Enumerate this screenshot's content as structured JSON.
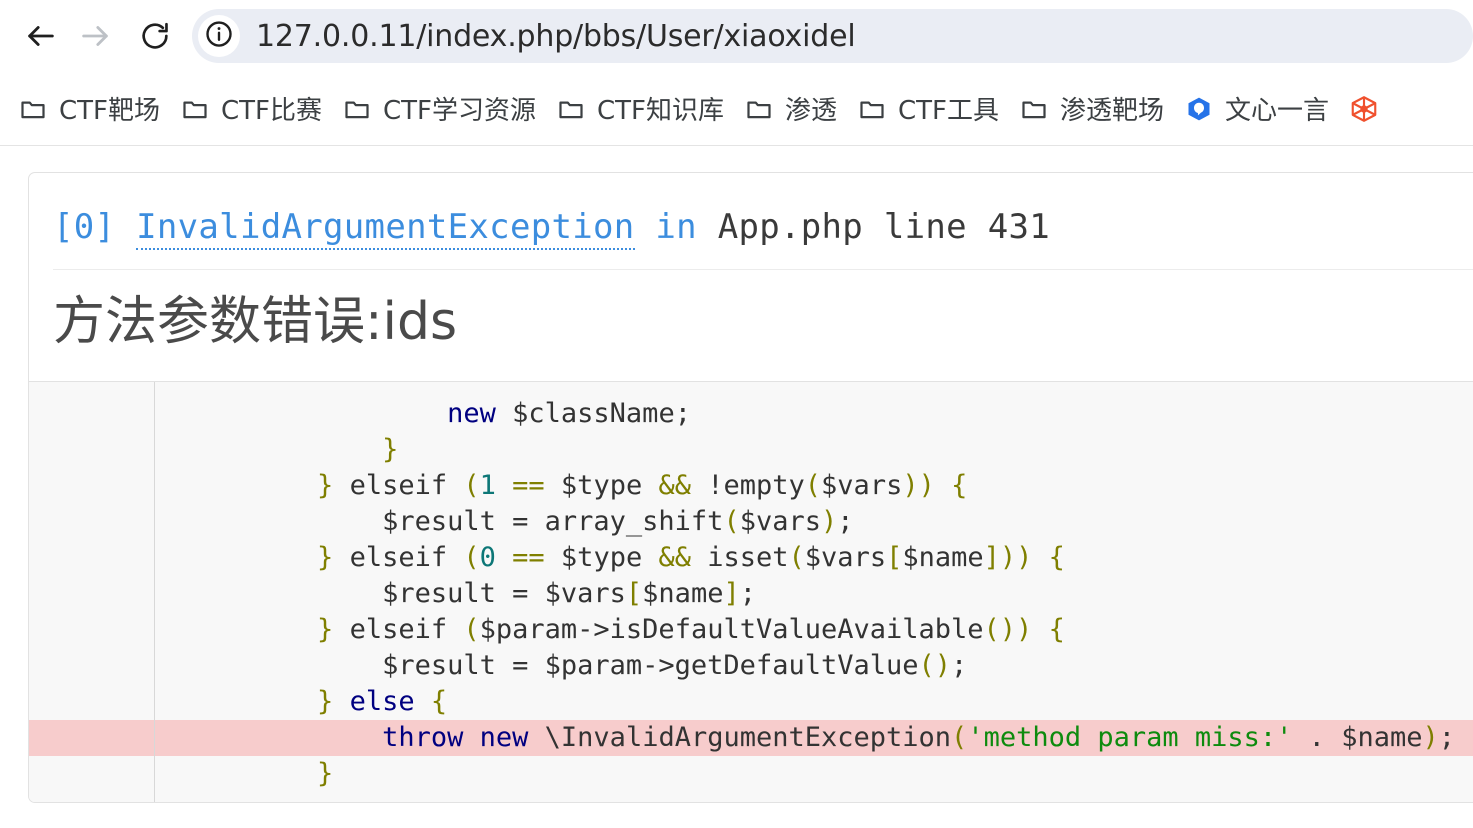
{
  "browser": {
    "toolbar": {
      "back_icon": "back-arrow-icon",
      "forward_icon": "forward-arrow-icon",
      "reload_icon": "reload-icon",
      "site_info_icon": "info-circle-icon",
      "url": "127.0.0.11/index.php/bbs/User/xiaoxidel"
    },
    "bookmarks": [
      {
        "label": "CTF靶场",
        "icon": "folder-icon"
      },
      {
        "label": "CTF比赛",
        "icon": "folder-icon"
      },
      {
        "label": "CTF学习资源",
        "icon": "folder-icon"
      },
      {
        "label": "CTF知识库",
        "icon": "folder-icon"
      },
      {
        "label": "渗透",
        "icon": "folder-icon"
      },
      {
        "label": "CTF工具",
        "icon": "folder-icon"
      },
      {
        "label": "渗透靶场",
        "icon": "folder-icon"
      },
      {
        "label": "文心一言",
        "icon": "ernie-bot-icon"
      },
      {
        "label": "",
        "icon": "hexagon-red-icon"
      }
    ]
  },
  "error_page": {
    "exception": {
      "index": "[0]",
      "class_name": "InvalidArgumentException",
      "in_word": "in",
      "file": "App.php",
      "line_word": "line",
      "line_number": "431",
      "message": "方法参数错误:ids"
    },
    "code": {
      "highlight_line_index": 9,
      "lines": [
        [
          {
            "text": "                ",
            "cls": "t-default"
          },
          {
            "text": "new",
            "cls": "t-kw"
          },
          {
            "text": " ",
            "cls": "t-default"
          },
          {
            "text": "$className",
            "cls": "t-default"
          },
          {
            "text": ";",
            "cls": "t-default"
          }
        ],
        [
          {
            "text": "            ",
            "cls": "t-default"
          },
          {
            "text": "}",
            "cls": "t-punct"
          }
        ],
        [
          {
            "text": "        ",
            "cls": "t-default"
          },
          {
            "text": "}",
            "cls": "t-punct"
          },
          {
            "text": " elseif ",
            "cls": "t-default"
          },
          {
            "text": "(",
            "cls": "t-punct"
          },
          {
            "text": "1",
            "cls": "t-num"
          },
          {
            "text": " ",
            "cls": "t-default"
          },
          {
            "text": "==",
            "cls": "t-op"
          },
          {
            "text": " $type ",
            "cls": "t-default"
          },
          {
            "text": "&&",
            "cls": "t-op"
          },
          {
            "text": " !empty",
            "cls": "t-default"
          },
          {
            "text": "(",
            "cls": "t-punct"
          },
          {
            "text": "$vars",
            "cls": "t-default"
          },
          {
            "text": "))",
            "cls": "t-punct"
          },
          {
            "text": " ",
            "cls": "t-default"
          },
          {
            "text": "{",
            "cls": "t-punct"
          }
        ],
        [
          {
            "text": "            $result = array_shift",
            "cls": "t-default"
          },
          {
            "text": "(",
            "cls": "t-punct"
          },
          {
            "text": "$vars",
            "cls": "t-default"
          },
          {
            "text": ")",
            "cls": "t-punct"
          },
          {
            "text": ";",
            "cls": "t-default"
          }
        ],
        [
          {
            "text": "        ",
            "cls": "t-default"
          },
          {
            "text": "}",
            "cls": "t-punct"
          },
          {
            "text": " elseif ",
            "cls": "t-default"
          },
          {
            "text": "(",
            "cls": "t-punct"
          },
          {
            "text": "0",
            "cls": "t-num"
          },
          {
            "text": " ",
            "cls": "t-default"
          },
          {
            "text": "==",
            "cls": "t-op"
          },
          {
            "text": " $type ",
            "cls": "t-default"
          },
          {
            "text": "&&",
            "cls": "t-op"
          },
          {
            "text": " isset",
            "cls": "t-default"
          },
          {
            "text": "(",
            "cls": "t-punct"
          },
          {
            "text": "$vars",
            "cls": "t-default"
          },
          {
            "text": "[",
            "cls": "t-punct"
          },
          {
            "text": "$name",
            "cls": "t-default"
          },
          {
            "text": "]))",
            "cls": "t-punct"
          },
          {
            "text": " ",
            "cls": "t-default"
          },
          {
            "text": "{",
            "cls": "t-punct"
          }
        ],
        [
          {
            "text": "            $result = $vars",
            "cls": "t-default"
          },
          {
            "text": "[",
            "cls": "t-punct"
          },
          {
            "text": "$name",
            "cls": "t-default"
          },
          {
            "text": "]",
            "cls": "t-punct"
          },
          {
            "text": ";",
            "cls": "t-default"
          }
        ],
        [
          {
            "text": "        ",
            "cls": "t-default"
          },
          {
            "text": "}",
            "cls": "t-punct"
          },
          {
            "text": " elseif ",
            "cls": "t-default"
          },
          {
            "text": "(",
            "cls": "t-punct"
          },
          {
            "text": "$param->isDefaultValueAvailable",
            "cls": "t-default"
          },
          {
            "text": "()) ",
            "cls": "t-punct"
          },
          {
            "text": "{",
            "cls": "t-punct"
          }
        ],
        [
          {
            "text": "            $result = $param->getDefaultValue",
            "cls": "t-default"
          },
          {
            "text": "()",
            "cls": "t-punct"
          },
          {
            "text": ";",
            "cls": "t-default"
          }
        ],
        [
          {
            "text": "        ",
            "cls": "t-default"
          },
          {
            "text": "}",
            "cls": "t-punct"
          },
          {
            "text": " ",
            "cls": "t-default"
          },
          {
            "text": "else",
            "cls": "t-kw"
          },
          {
            "text": " ",
            "cls": "t-default"
          },
          {
            "text": "{",
            "cls": "t-punct"
          }
        ],
        [
          {
            "text": "            ",
            "cls": "t-default"
          },
          {
            "text": "throw",
            "cls": "t-kw"
          },
          {
            "text": " ",
            "cls": "t-default"
          },
          {
            "text": "new",
            "cls": "t-kw"
          },
          {
            "text": " \\InvalidArgumentException",
            "cls": "t-class"
          },
          {
            "text": "(",
            "cls": "t-punct"
          },
          {
            "text": "'method param miss:'",
            "cls": "t-str"
          },
          {
            "text": " . $name",
            "cls": "t-default"
          },
          {
            "text": ")",
            "cls": "t-punct"
          },
          {
            "text": ";",
            "cls": "t-default"
          }
        ],
        [
          {
            "text": "        ",
            "cls": "t-default"
          },
          {
            "text": "}",
            "cls": "t-punct"
          }
        ]
      ]
    }
  },
  "colors": {
    "link_blue": "#3c8dde",
    "code_bg": "#f8f8f8",
    "highlight_bg": "#f7cccc",
    "omnibox_bg": "#eaedf4",
    "keyword": "#000080",
    "string": "#0e8b0e",
    "punct": "#7f7f00",
    "number": "#0d7777"
  }
}
